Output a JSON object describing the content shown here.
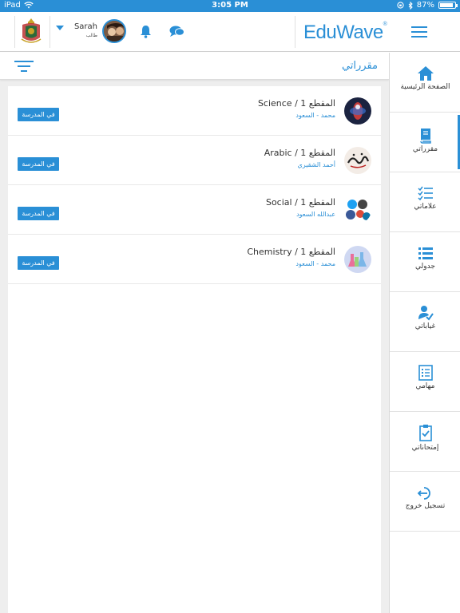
{
  "status_bar": {
    "device": "iPad",
    "time": "3:05 PM",
    "battery": "87%",
    "battery_level": 0.87
  },
  "header": {
    "user_name": "Sarah",
    "user_role": "طالب",
    "logo_edu": "Edu",
    "logo_wave": "Wave",
    "logo_mark": "®"
  },
  "page": {
    "title": "مقرراتي"
  },
  "courses": [
    {
      "name": "Science / المقطع 1",
      "teacher": "محمد  -  السعود",
      "status": "في المدرسة",
      "thumb": "science"
    },
    {
      "name": "Arabic  / المقطع 1",
      "teacher": "أحمد   الشقيري",
      "status": "في المدرسة",
      "thumb": "arabic"
    },
    {
      "name": "Social  / المقطع 1",
      "teacher": "عبدالله    السعود",
      "status": "في المدرسة",
      "thumb": "social"
    },
    {
      "name": "Chemistry  / المقطع 1",
      "teacher": "محمد  -  السعود",
      "status": "في المدرسة",
      "thumb": "chemistry"
    }
  ],
  "sidebar": {
    "items": [
      {
        "label": "الصفحة الرئيسية",
        "icon": "home-icon"
      },
      {
        "label": "مقرراتي",
        "icon": "book-icon",
        "active": true
      },
      {
        "label": "علاماتي",
        "icon": "checklist-icon"
      },
      {
        "label": "جدولي",
        "icon": "list-icon"
      },
      {
        "label": "غياباتي",
        "icon": "user-check-icon"
      },
      {
        "label": "مهامي",
        "icon": "tasks-icon"
      },
      {
        "label": "إمتحاناتي",
        "icon": "clipboard-check-icon"
      },
      {
        "label": "تسجيل خروج",
        "icon": "logout-icon"
      }
    ]
  },
  "colors": {
    "accent": "#2a8fd6",
    "background": "#eeeeee"
  }
}
